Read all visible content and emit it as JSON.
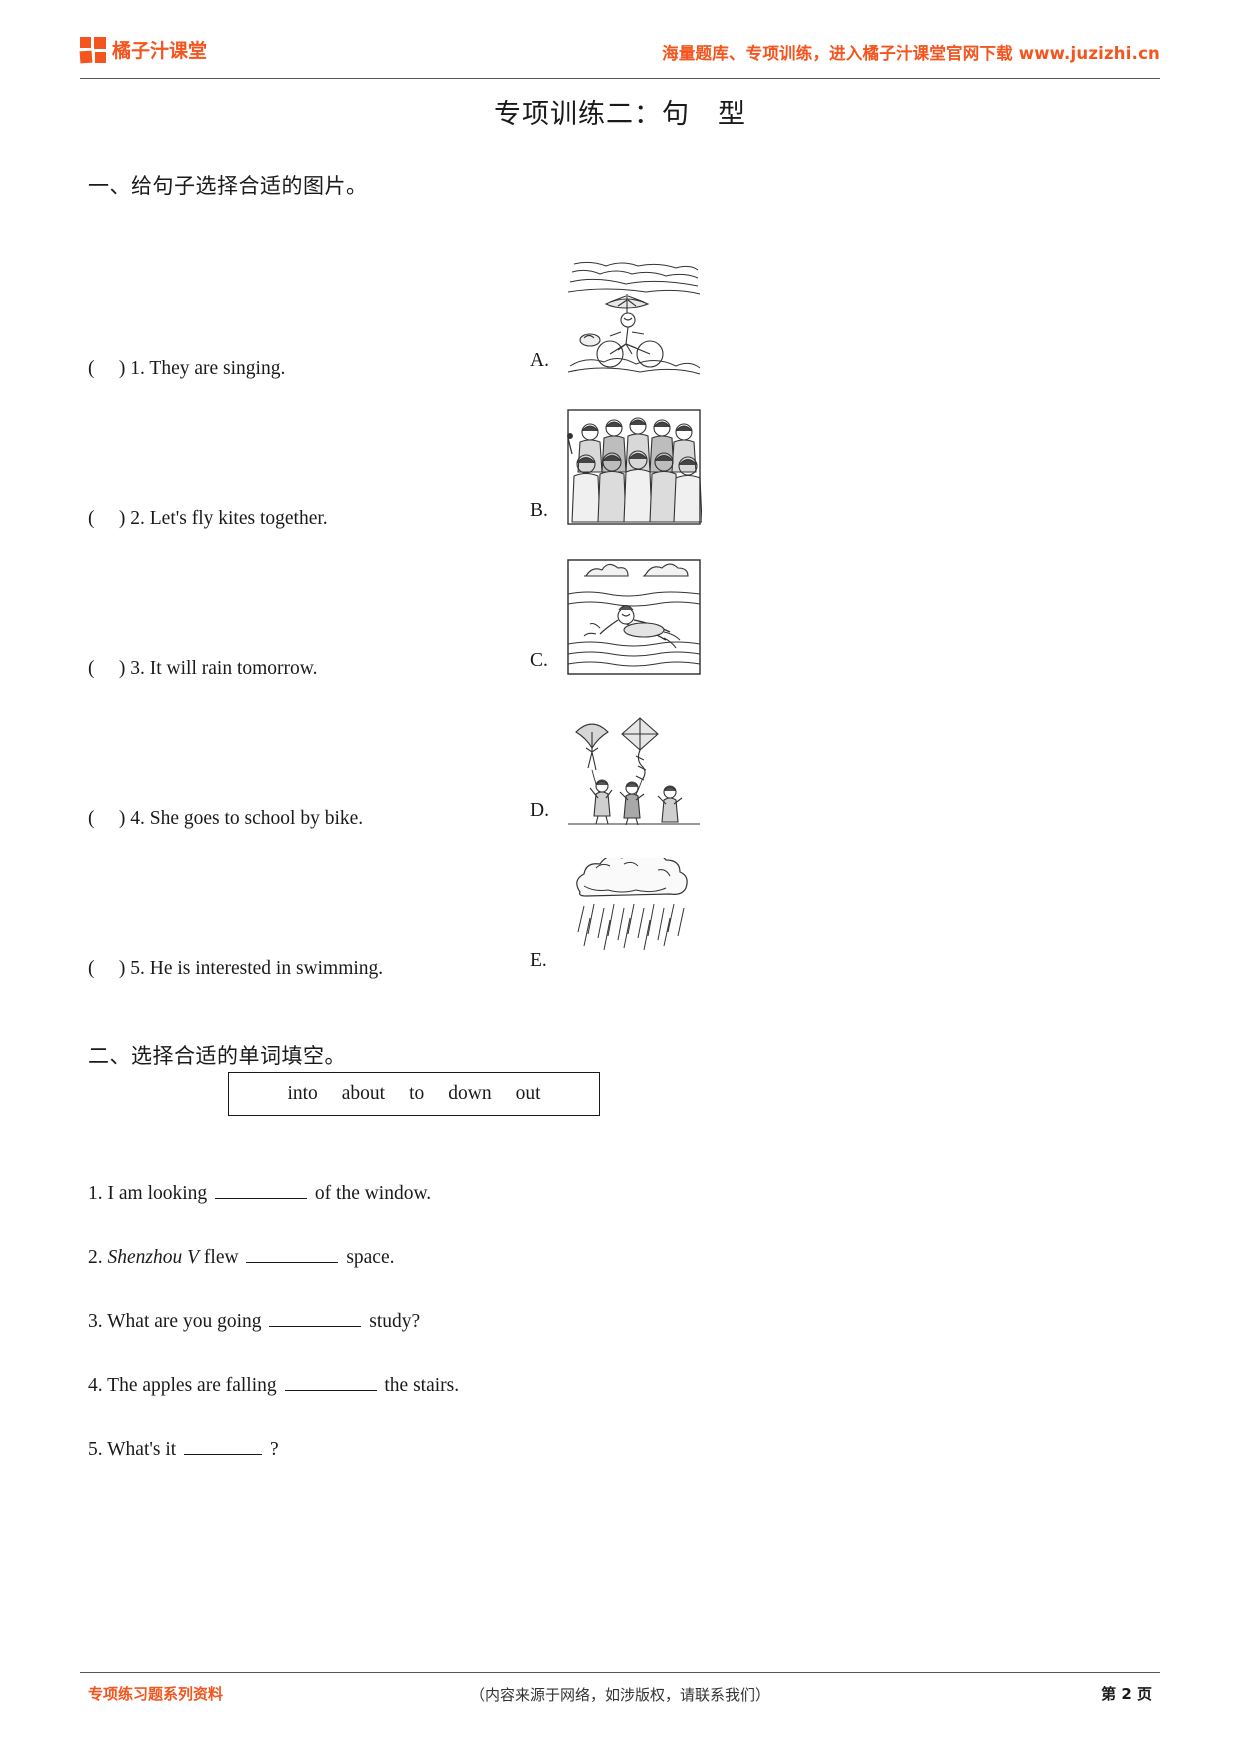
{
  "header": {
    "brand_name": "橘子汁课堂",
    "logo_icon": "four-square-grid-icon",
    "tagline": "海量题库、专项训练，进入橘子汁课堂官网下载 www.juzizhi.cn",
    "accent_color": "#F4551E"
  },
  "title": "专项训练二：句　型",
  "sections": [
    {
      "heading": "一、给句子选择合适的图片。",
      "questions": [
        {
          "prefix": "(",
          "suffix": ")",
          "number": "1.",
          "text": "They are singing."
        },
        {
          "prefix": "(",
          "suffix": ")",
          "number": "2.",
          "text": "Let's fly kites together."
        },
        {
          "prefix": "(",
          "suffix": ")",
          "number": "3.",
          "text": "It will rain tomorrow."
        },
        {
          "prefix": "(",
          "suffix": ")",
          "number": "4.",
          "text": "She goes to school by bike."
        },
        {
          "prefix": "(",
          "suffix": ")",
          "number": "5.",
          "text": "He is interested in swimming."
        }
      ],
      "pictures": [
        {
          "letter": "A.",
          "icon": "girl-riding-bicycle-in-rain-icon"
        },
        {
          "letter": "B.",
          "icon": "choir-group-singing-icon"
        },
        {
          "letter": "C.",
          "icon": "person-swimming-icon"
        },
        {
          "letter": "D.",
          "icon": "children-flying-kites-icon"
        },
        {
          "letter": "E.",
          "icon": "rain-clouds-icon"
        }
      ]
    },
    {
      "heading": "二、选择合适的单词填空。",
      "word_bank": [
        "into",
        "about",
        "to",
        "down",
        "out"
      ],
      "questions": [
        {
          "number": "1.",
          "before": "I am looking",
          "after": "of the window.",
          "italic_part": ""
        },
        {
          "number": "2.",
          "before_italic": "Shenzhou V",
          "before": "flew",
          "after": "space."
        },
        {
          "number": "3.",
          "before": "What are you going",
          "after": "study?"
        },
        {
          "number": "4.",
          "before": "The apples are falling",
          "after": "the stairs."
        },
        {
          "number": "5.",
          "before": "What's it",
          "after": "?"
        }
      ]
    }
  ],
  "footer": {
    "left": "专项练习题系列资料",
    "center": "（内容来源于网络，如涉版权，请联系我们）",
    "page_label": "第 2 页"
  }
}
